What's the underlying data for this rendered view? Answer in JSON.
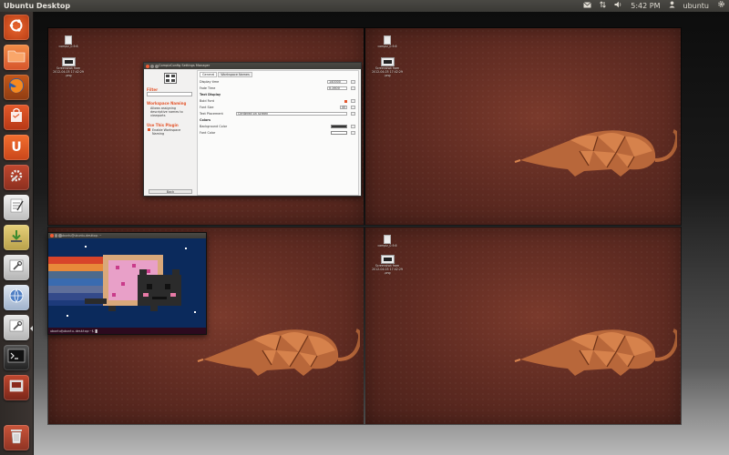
{
  "top_panel": {
    "title": "Ubuntu Desktop",
    "time": "5:42 PM",
    "user": "ubuntu",
    "icons": [
      "mail-icon",
      "network-icon",
      "volume-icon",
      "user-icon",
      "gear-icon"
    ]
  },
  "launcher": {
    "items": [
      {
        "name": "dash-home",
        "icon": "ubuntu-logo-icon"
      },
      {
        "name": "home-folder",
        "icon": "folder-icon"
      },
      {
        "name": "firefox",
        "icon": "firefox-icon"
      },
      {
        "name": "software-center",
        "icon": "shopping-bag-icon"
      },
      {
        "name": "ubuntu-one",
        "icon": "ubuntu-one-icon"
      },
      {
        "name": "system-settings",
        "icon": "settings-icon"
      },
      {
        "name": "text-editor",
        "icon": "text-editor-icon"
      },
      {
        "name": "update-manager",
        "icon": "download-icon"
      },
      {
        "name": "ccsm",
        "icon": "wrench-icon"
      },
      {
        "name": "web-browser",
        "icon": "globe-icon"
      },
      {
        "name": "ccsm-running",
        "icon": "wrench-icon"
      },
      {
        "name": "terminal",
        "icon": "terminal-icon"
      },
      {
        "name": "workspace-switcher",
        "icon": "workspace-icon"
      },
      {
        "name": "trash",
        "icon": "trash-icon"
      }
    ]
  },
  "workspaces": {
    "ws1": {
      "icons": [
        {
          "label": "compiz_0.9.6",
          "kind": "file"
        },
        {
          "label": "Screenshot from\n2012-04-03 17:42:29\n.png",
          "kind": "screenshot"
        }
      ]
    },
    "ws2": {
      "icons": [
        {
          "label": "compiz_0.9.6",
          "kind": "file"
        },
        {
          "label": "Screenshot from\n2012-04-03 17:42:29\n.png",
          "kind": "screenshot"
        }
      ]
    },
    "ws4": {
      "icons": [
        {
          "label": "compiz_0.9.6",
          "kind": "file"
        },
        {
          "label": "Screenshot from\n2012-04-03 17:42:29\n.png",
          "kind": "screenshot"
        }
      ]
    }
  },
  "ccsm_window": {
    "title": "CompizConfig Settings Manager",
    "filter_heading": "Filter",
    "section_heading": "Workspace Naming",
    "section_desc": "Allows assigning descriptive names to viewports",
    "use_heading": "Use This Plugin",
    "use_label": "Enable Workspace Naming",
    "back_label": "Back",
    "tabs": [
      "General",
      "Workspace Names"
    ],
    "rows": [
      {
        "label": "Display time",
        "value": "140000"
      },
      {
        "label": "Fade Time",
        "value": "0.2600"
      },
      {
        "label": "Text Display",
        "section": true
      },
      {
        "label": "Bold Font",
        "kind": "check"
      },
      {
        "label": "Font Size",
        "value": "40"
      },
      {
        "label": "Text Placement",
        "wide": "Centered on screen"
      },
      {
        "label": "Colors",
        "section": true
      },
      {
        "label": "Background Color",
        "kind": "color",
        "color": "#333333"
      },
      {
        "label": "Font Color",
        "kind": "color",
        "color": "#ffffff"
      }
    ]
  },
  "terminal_window": {
    "title": "ubuntu@ubuntu-desktop: ~",
    "prompt": "ubuntu@ubuntu-desktop:~$ █"
  },
  "colors": {
    "accent": "#e4572e",
    "wallpaper": "#5d2a21",
    "panel": "#3c3b37"
  }
}
